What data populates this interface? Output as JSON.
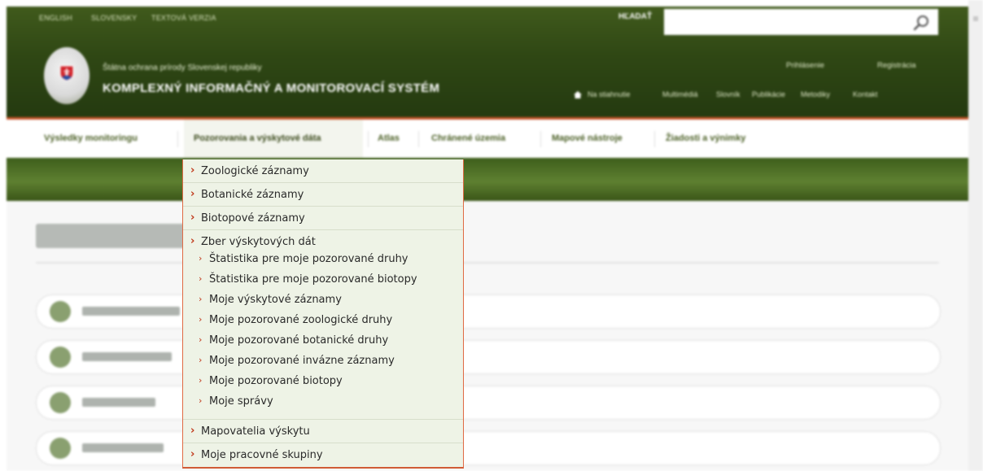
{
  "header": {
    "lang_links": [
      "ENGLISH",
      "SLOVENSKY",
      "TEXTOVÁ VERZIA"
    ],
    "search_label": "HĽADAŤ",
    "search_value": "",
    "org_name": "Štátna ochrana prírody Slovenskej republiky",
    "system_name": "KOMPLEXNÝ INFORMAČNÝ A MONITOROVACÍ SYSTÉM",
    "util_links": [
      "Prihlásenie",
      "Registrácia"
    ],
    "top_links": [
      "Na stiahnutie",
      "Multimédiá",
      "Slovník",
      "Publikácie",
      "Metodiky",
      "Kontakt"
    ]
  },
  "nav": {
    "items": [
      "Výsledky monitoringu",
      "Pozorovania a výskytové dáta",
      "Atlas",
      "Chránené územia",
      "Mapové nástroje",
      "Žiadosti a výnimky"
    ],
    "active_index": 1
  },
  "dropdown": {
    "top_items": [
      "Zoologické záznamy",
      "Botanické záznamy",
      "Biotopové záznamy"
    ],
    "group_title": "Zber výskytových dát",
    "group_items": [
      "Štatistika pre moje pozorované druhy",
      "Štatistika pre moje pozorované biotopy",
      "Moje výskytové záznamy",
      "Moje pozorované zoologické druhy",
      "Moje pozorované botanické druhy",
      "Moje pozorované invázne záznamy",
      "Moje pozorované biotopy",
      "Moje správy"
    ],
    "bottom_items": [
      "Mapovatelia výskytu",
      "Moje pracovné skupiny"
    ]
  },
  "colors": {
    "header_green": "#2f4714",
    "accent_orange": "#c75327",
    "nav_text": "#4d6128",
    "dropdown_bg": "#eef3e6",
    "chevron_red": "#c0391b"
  },
  "icons": [
    "search-icon",
    "home-icon",
    "chevron-right-icon",
    "slovak-emblem-logo"
  ]
}
